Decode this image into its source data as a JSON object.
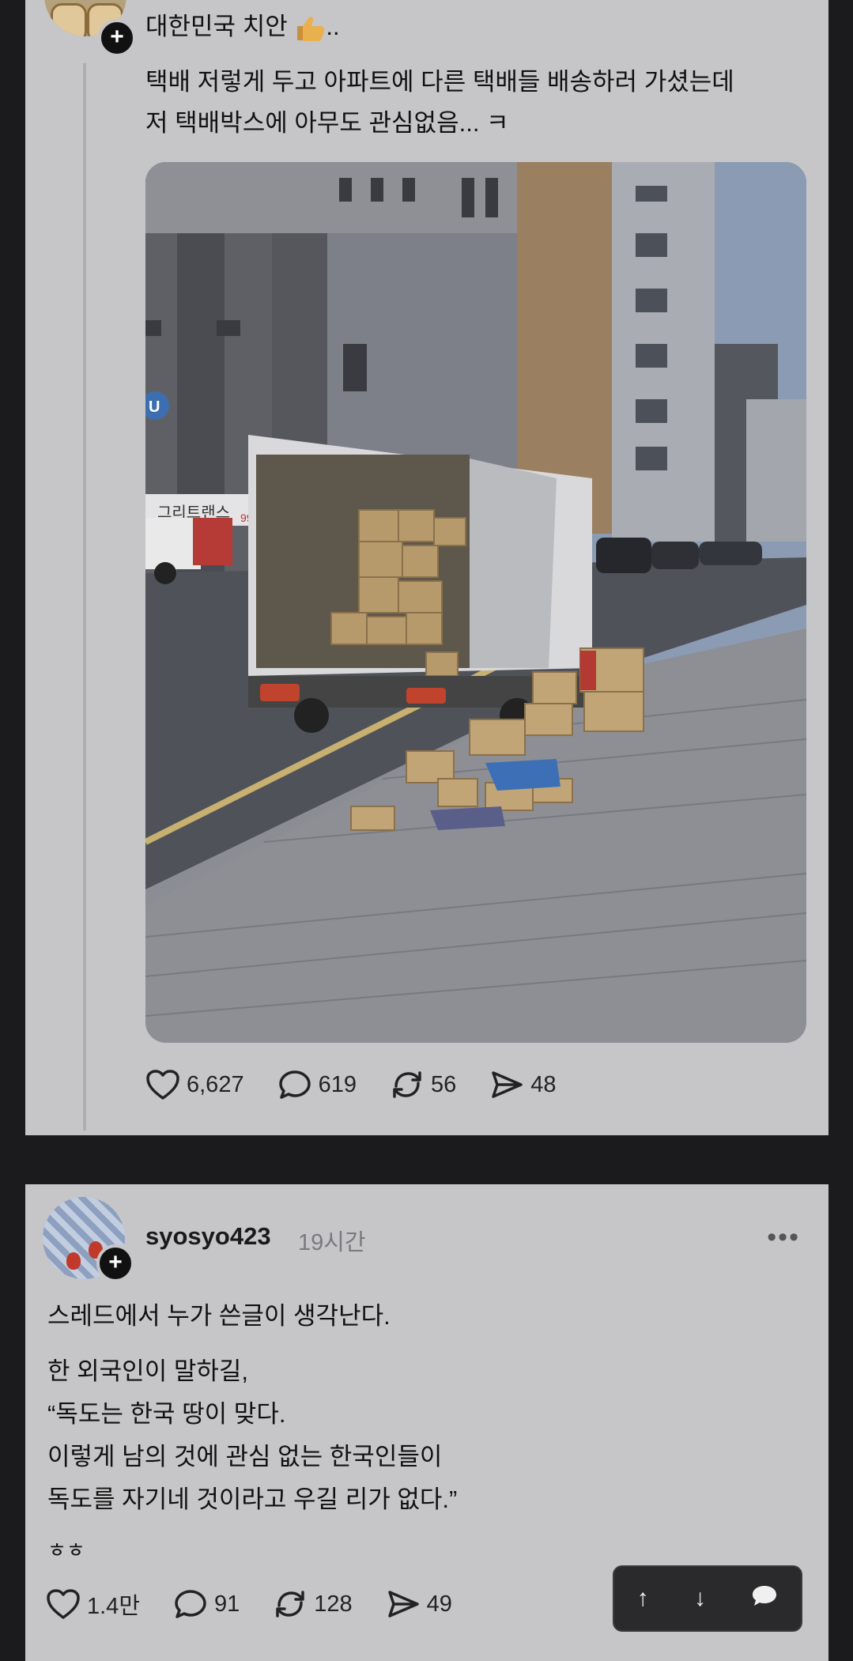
{
  "post1": {
    "title": "대한민국 치안",
    "title_suffix": "..",
    "body_line1": "택배 저렇게 두고 아파트에 다른 택배들 배송하러 가셨는데",
    "body_line2": "저 택배박스에 아무도 관심없음... ㅋ",
    "photo_sign_text": "그리트랜스",
    "photo_sign_number": "995",
    "photo_sign_letter": "U",
    "likes": "6,627",
    "comments": "619",
    "reposts": "56",
    "shares": "48"
  },
  "post2": {
    "username": "syosyo423",
    "time": "19시간",
    "more": "•••",
    "line1": "스레드에서 누가 쓴글이 생각난다.",
    "line2": "한 외국인이 말하길,",
    "line3": "“독도는 한국 땅이 맞다.",
    "line4": "이렇게 남의 것에 관심 없는 한국인들이",
    "line5": "독도를 자기네 것이라고 우길 리가 없다.”",
    "line6": "ㅎㅎ",
    "likes": "1.4만",
    "comments": "91",
    "reposts": "128",
    "shares": "49"
  },
  "floating_bar": {
    "up": "↑",
    "down": "↓"
  }
}
